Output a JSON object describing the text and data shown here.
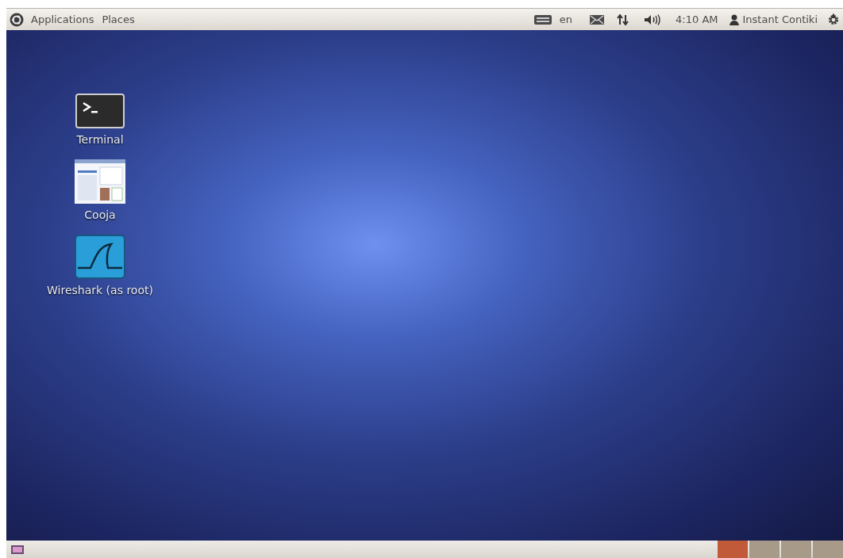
{
  "top_panel": {
    "menus": [
      "Applications",
      "Places"
    ],
    "keyboard_layout": "en",
    "clock": "4:10 AM",
    "user": "Instant Contiki"
  },
  "desktop_icons": [
    {
      "label": "Terminal",
      "kind": "terminal"
    },
    {
      "label": "Cooja",
      "kind": "window"
    },
    {
      "label": "Wireshark (as root)",
      "kind": "fin"
    }
  ],
  "bottom_panel": {
    "workspaces": [
      {
        "selected": true
      },
      {
        "selected": false
      },
      {
        "selected": false
      },
      {
        "selected": false
      }
    ]
  }
}
